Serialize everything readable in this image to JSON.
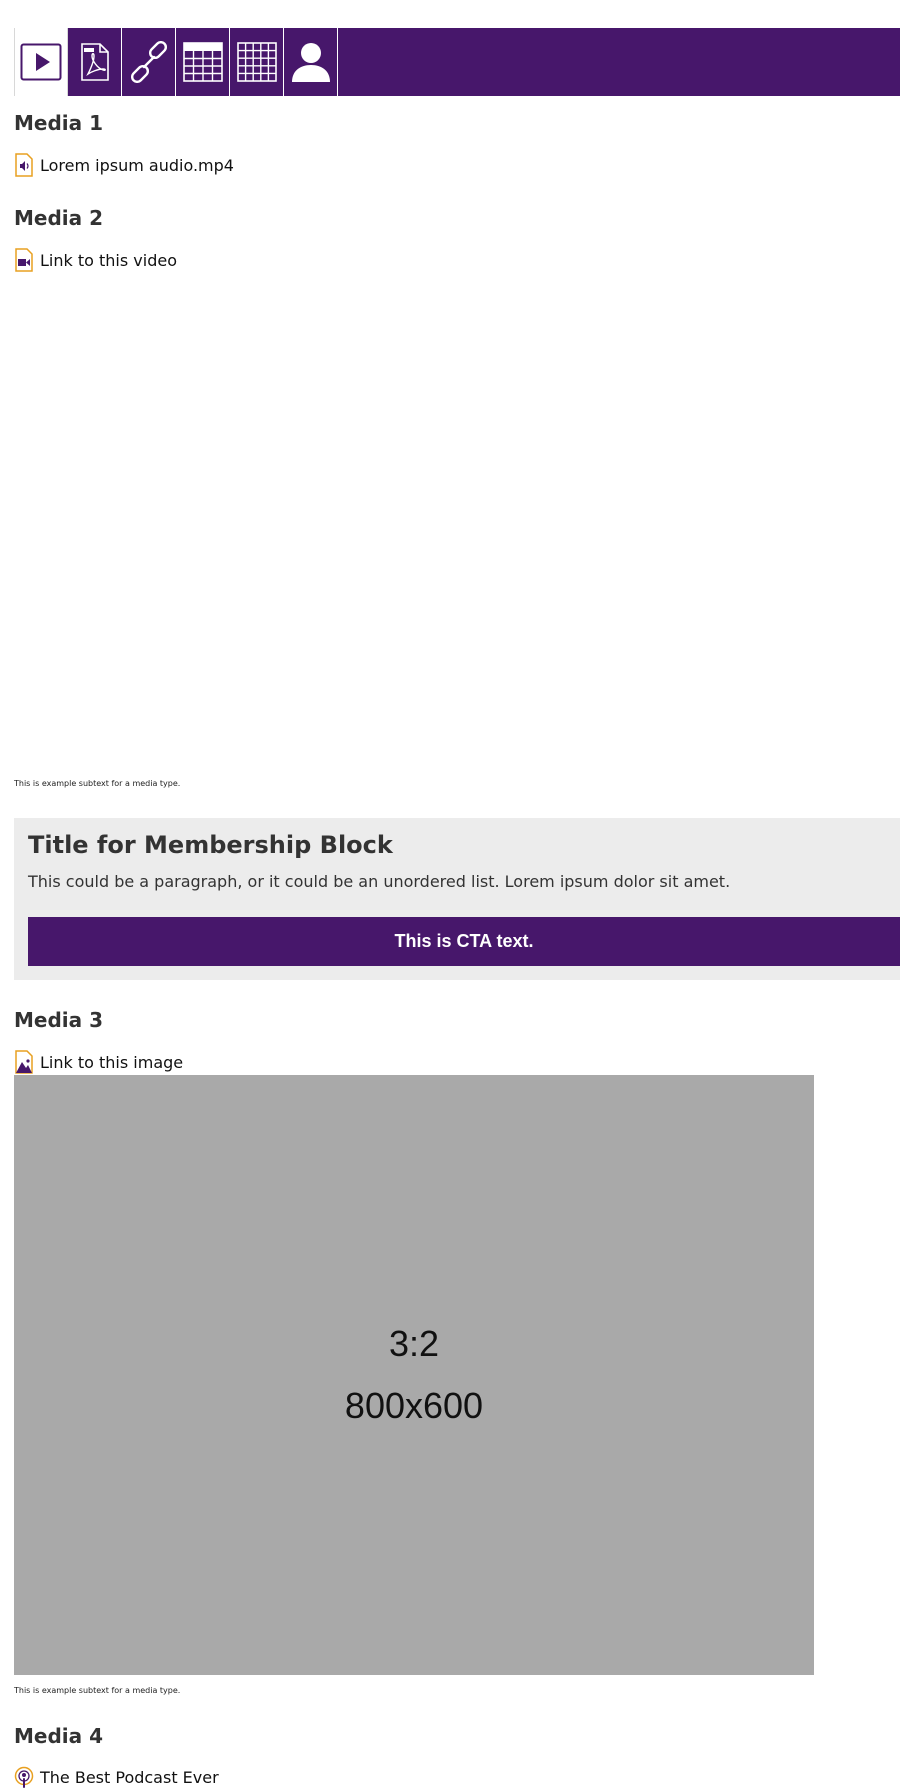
{
  "toolbar": {
    "items": [
      {
        "name": "video",
        "icon": "play-icon",
        "active": true
      },
      {
        "name": "pdf",
        "icon": "pdf-icon"
      },
      {
        "name": "link",
        "icon": "link-icon"
      },
      {
        "name": "table",
        "icon": "table-icon"
      },
      {
        "name": "grid",
        "icon": "grid-icon"
      },
      {
        "name": "profile",
        "icon": "person-icon"
      }
    ],
    "color": "#47176b"
  },
  "media1": {
    "title": "Media 1",
    "link_text": "Lorem ipsum audio.mp4",
    "icon": "audio-file-icon"
  },
  "media2": {
    "title": "Media 2",
    "link_text": "Link to this video",
    "icon": "video-file-icon",
    "subtext": "This is example subtext for a media type."
  },
  "membership": {
    "title": "Title for Membership Block",
    "body": "This could be a paragraph, or it could be an unordered list. Lorem ipsum dolor sit amet.",
    "cta": "This is CTA text."
  },
  "media3": {
    "title": "Media 3",
    "link_text": "Link to this image",
    "icon": "image-file-icon",
    "placeholder": {
      "ratio": "3:2",
      "dims": "800x600"
    },
    "subtext": "This is example subtext for a media type."
  },
  "media4": {
    "title": "Media 4",
    "link_text": "The Best Podcast Ever",
    "icon": "podcast-icon"
  },
  "colors": {
    "brand_purple": "#47176b",
    "file_icon_orange": "#e8a020",
    "placeholder_gray": "#a9a9a9",
    "membership_bg": "#ececec"
  }
}
